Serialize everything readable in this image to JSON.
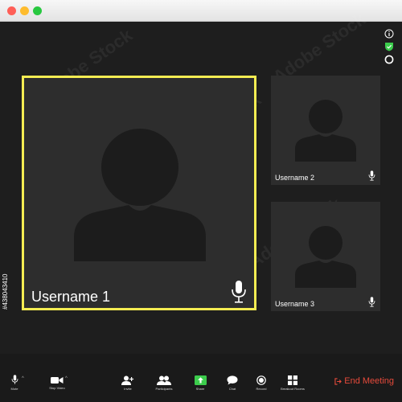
{
  "window": {
    "controls": [
      "close",
      "minimize",
      "maximize"
    ]
  },
  "status_icons": [
    "info-icon",
    "shield-check-icon",
    "record-indicator-icon"
  ],
  "participants": [
    {
      "name": "Username 1",
      "active": true,
      "highlight_color": "#f4ec52"
    },
    {
      "name": "Username 2",
      "active": false
    },
    {
      "name": "Username 3",
      "active": false
    }
  ],
  "toolbar": {
    "mute_label": "Mute",
    "stop_video_label": "Stop Video",
    "invite_label": "Invite",
    "participants_label": "Participants",
    "share_label": "Share",
    "chat_label": "Chat",
    "record_label": "Record",
    "breakout_rooms_label": "Breakout Rooms",
    "end_meeting_label": "End Meeting"
  },
  "colors": {
    "share_green": "#3ccc4c",
    "end_red": "#e64a3b",
    "tile_bg": "#2d2d2d",
    "window_bg": "#1e1e1e"
  },
  "watermark": {
    "text": "Adobe Stock",
    "side_id": "#438043410"
  }
}
